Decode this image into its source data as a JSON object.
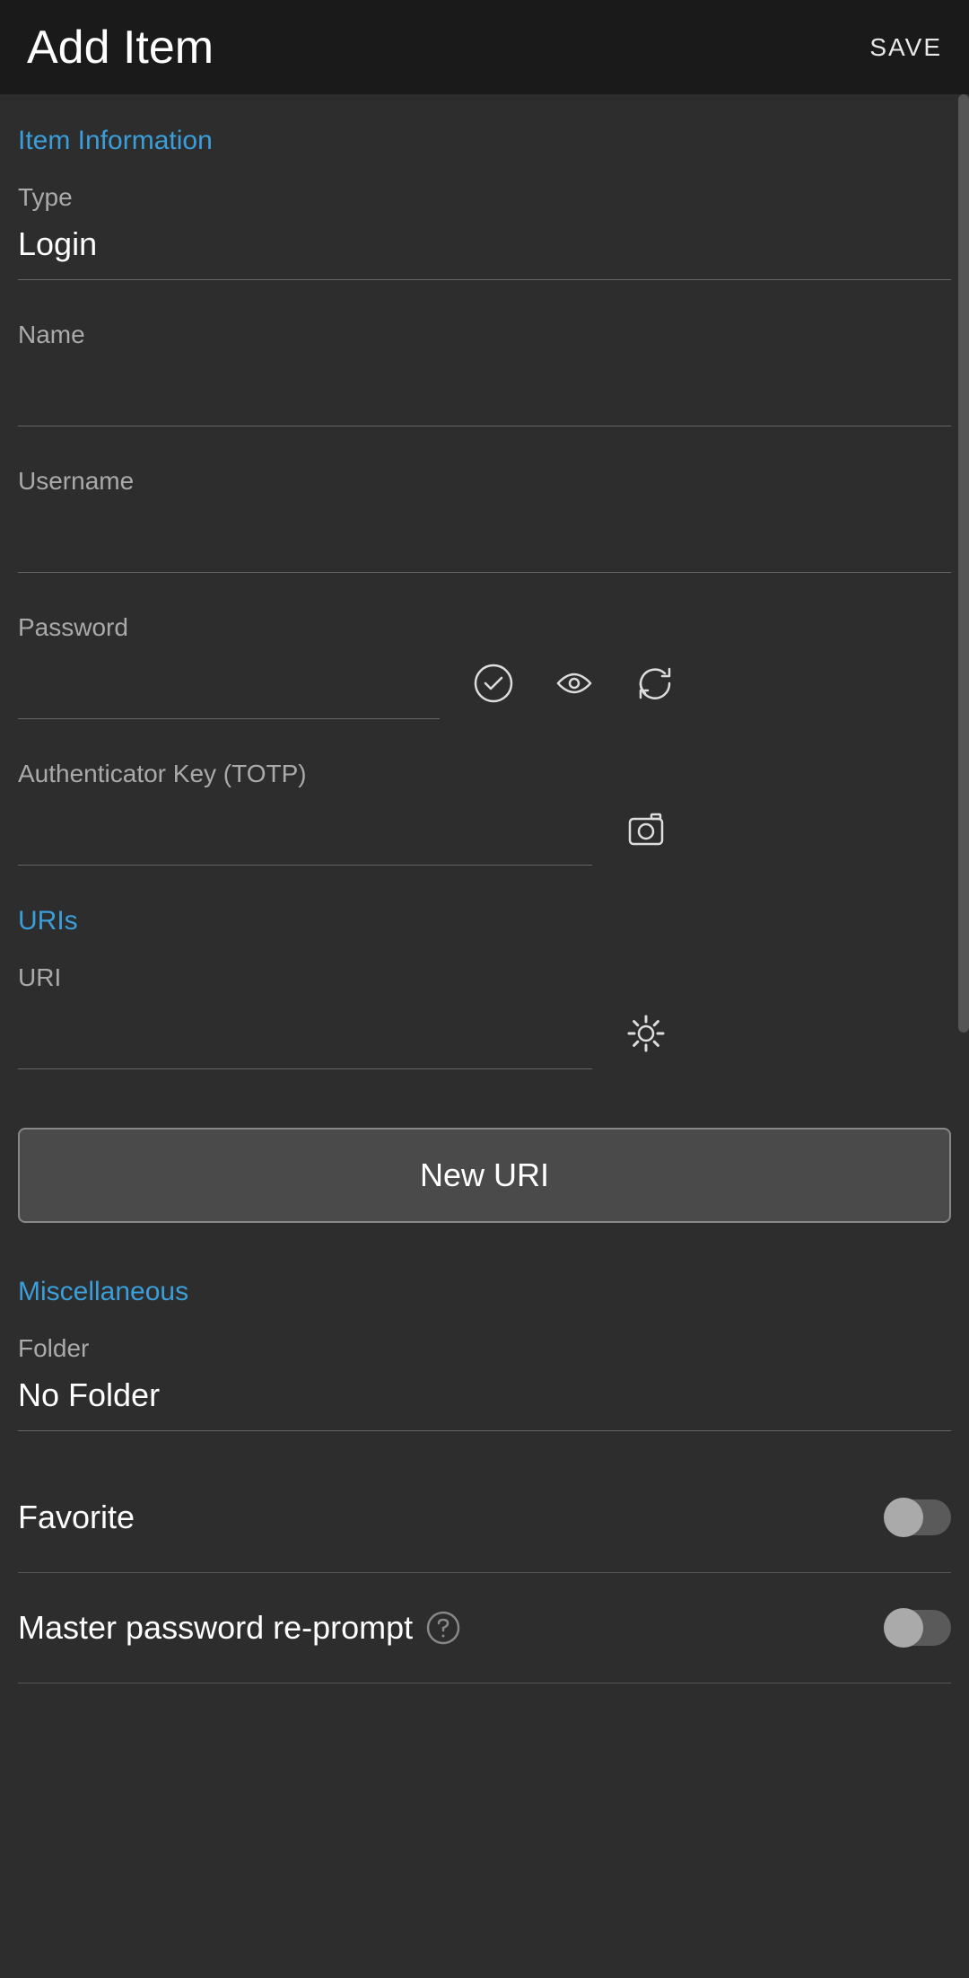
{
  "header": {
    "title": "Add Item",
    "save": "SAVE"
  },
  "sections": {
    "itemInfo": "Item Information",
    "uris": "URIs",
    "misc": "Miscellaneous"
  },
  "labels": {
    "type": "Type",
    "name": "Name",
    "username": "Username",
    "password": "Password",
    "totp": "Authenticator Key (TOTP)",
    "uri": "URI",
    "folder": "Folder",
    "favorite": "Favorite",
    "masterPrompt": "Master password re-prompt"
  },
  "values": {
    "type": "Login",
    "name": "",
    "username": "",
    "password": "",
    "totp": "",
    "uri": "",
    "folder": "No Folder"
  },
  "buttons": {
    "newUri": "New URI"
  },
  "toggles": {
    "favorite": false,
    "masterPrompt": false
  }
}
